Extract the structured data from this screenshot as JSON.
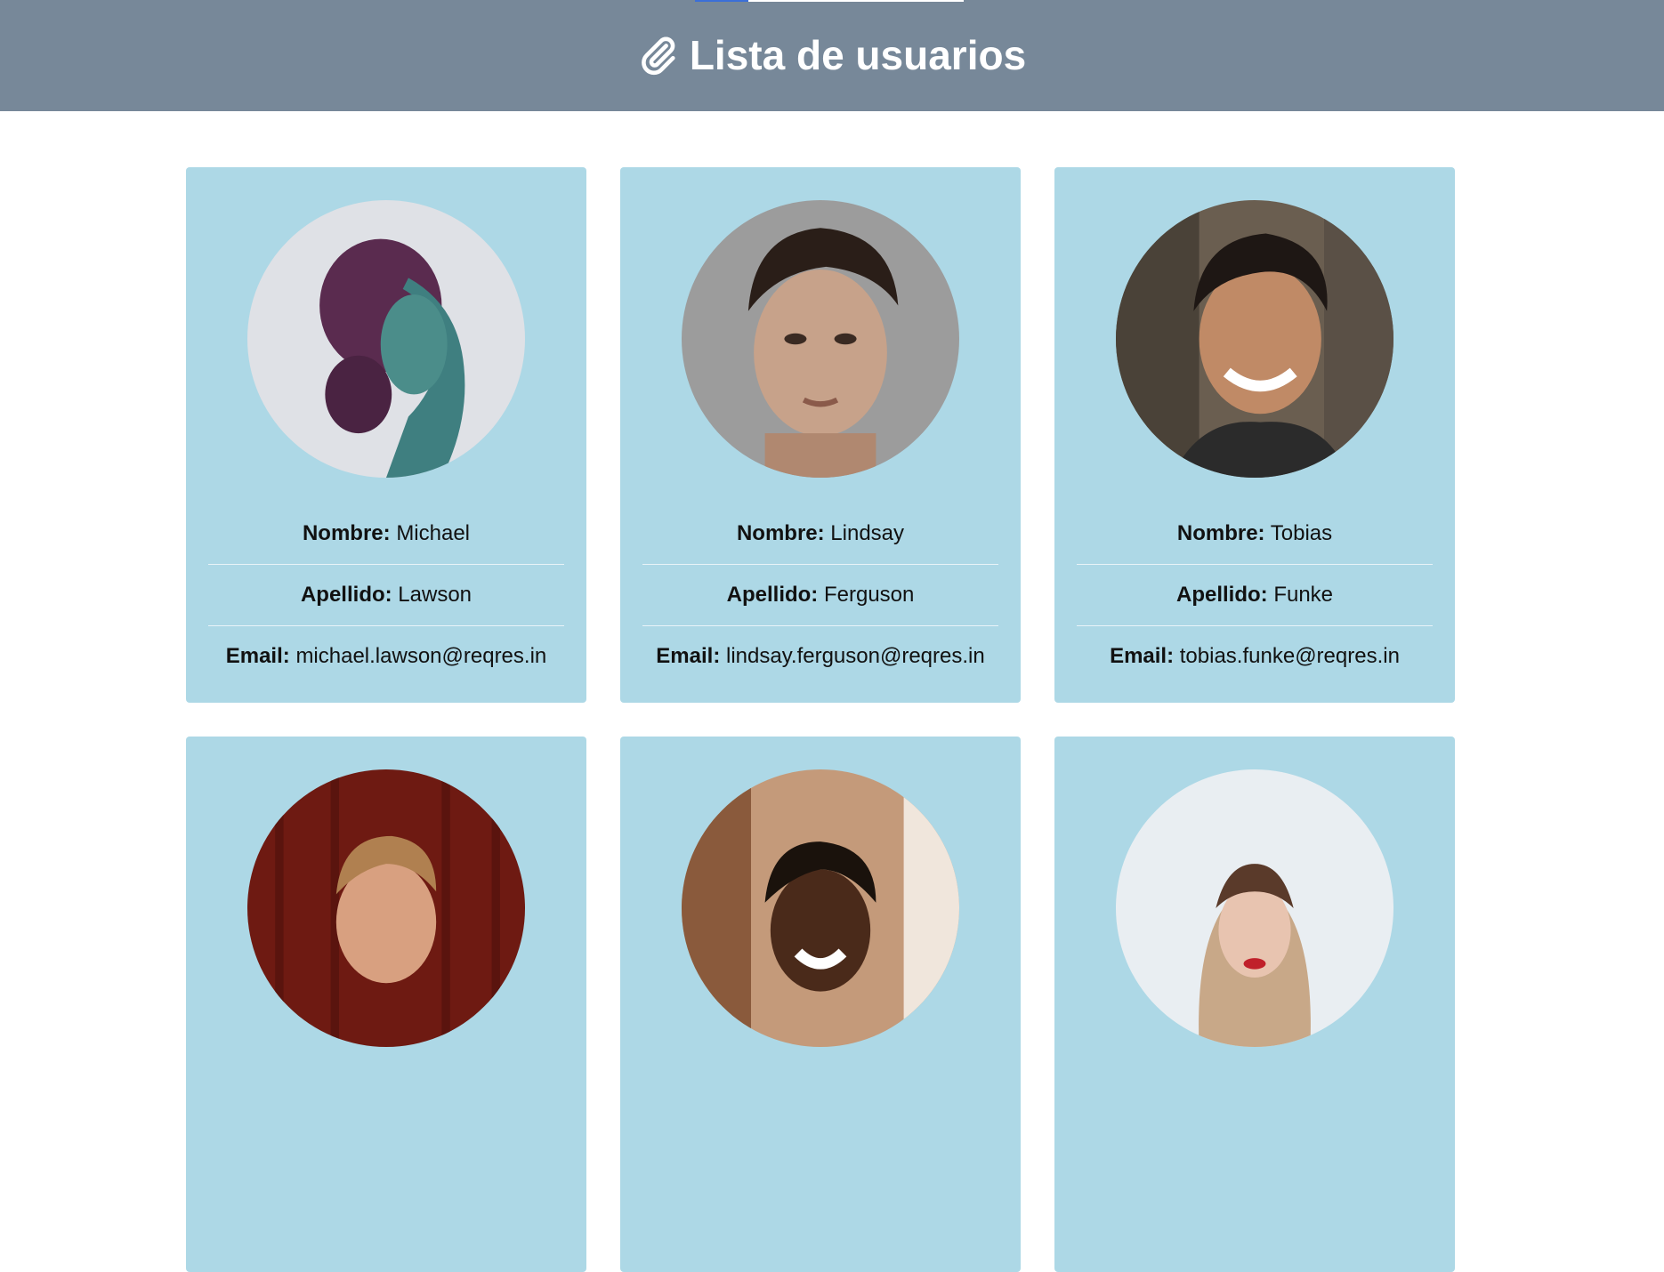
{
  "header": {
    "title": "Lista de usuarios",
    "icon": "paperclip-icon",
    "background": "#778899"
  },
  "labels": {
    "first_name": "Nombre:",
    "last_name": "Apellido:",
    "email": "Email:"
  },
  "users": [
    {
      "first_name": "Michael",
      "last_name": "Lawson",
      "email": "michael.lawson@reqres.in",
      "avatar_tone": "#5a2b4f"
    },
    {
      "first_name": "Lindsay",
      "last_name": "Ferguson",
      "email": "lindsay.ferguson@reqres.in",
      "avatar_tone": "#6b6b6b"
    },
    {
      "first_name": "Tobias",
      "last_name": "Funke",
      "email": "tobias.funke@reqres.in",
      "avatar_tone": "#4a4238"
    },
    {
      "first_name": "",
      "last_name": "",
      "email": "",
      "avatar_tone": "#6e1a12"
    },
    {
      "first_name": "",
      "last_name": "",
      "email": "",
      "avatar_tone": "#8a5a3c"
    },
    {
      "first_name": "",
      "last_name": "",
      "email": "",
      "avatar_tone": "#e9eef2"
    }
  ],
  "card_color": "#add8e6"
}
